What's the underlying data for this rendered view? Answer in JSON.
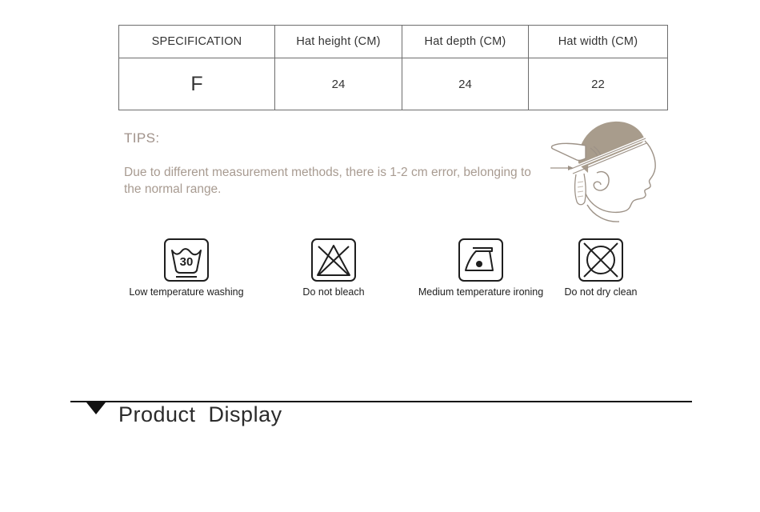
{
  "size_table": {
    "columns": [
      "SPECIFICATION",
      "Hat height (CM)",
      "Hat depth (CM)",
      "Hat width (CM)"
    ],
    "rows": [
      {
        "specification": "F",
        "hat_height": "24",
        "hat_depth": "24",
        "hat_width": "22"
      }
    ]
  },
  "tips": {
    "title": "TIPS:",
    "body": "Due to different measurement methods, there is 1-2 cm error, belonging to the normal range."
  },
  "illustration": {
    "name": "head-with-cap-measurement-diagram",
    "cap_color": "#a89c8c",
    "outline_color": "#9d9287"
  },
  "care_instructions": [
    {
      "icon": "wash-tub-30-icon",
      "label": "Low temperature washing",
      "temperature": "30"
    },
    {
      "icon": "do-not-bleach-icon",
      "label": "Do not bleach"
    },
    {
      "icon": "iron-one-dot-icon",
      "label": "Medium temperature ironing"
    },
    {
      "icon": "do-not-dry-clean-icon",
      "label": "Do not dry clean"
    }
  ],
  "section": {
    "title": "Product  Display",
    "marker_icon": "triangle-down-icon"
  },
  "colors": {
    "text": "#2b2b2b",
    "tips_text": "#a89b91",
    "tips_title": "#a0928a",
    "table_border": "#6d6d6d",
    "rule": "#111111",
    "cap_fill": "#a89c8c"
  }
}
